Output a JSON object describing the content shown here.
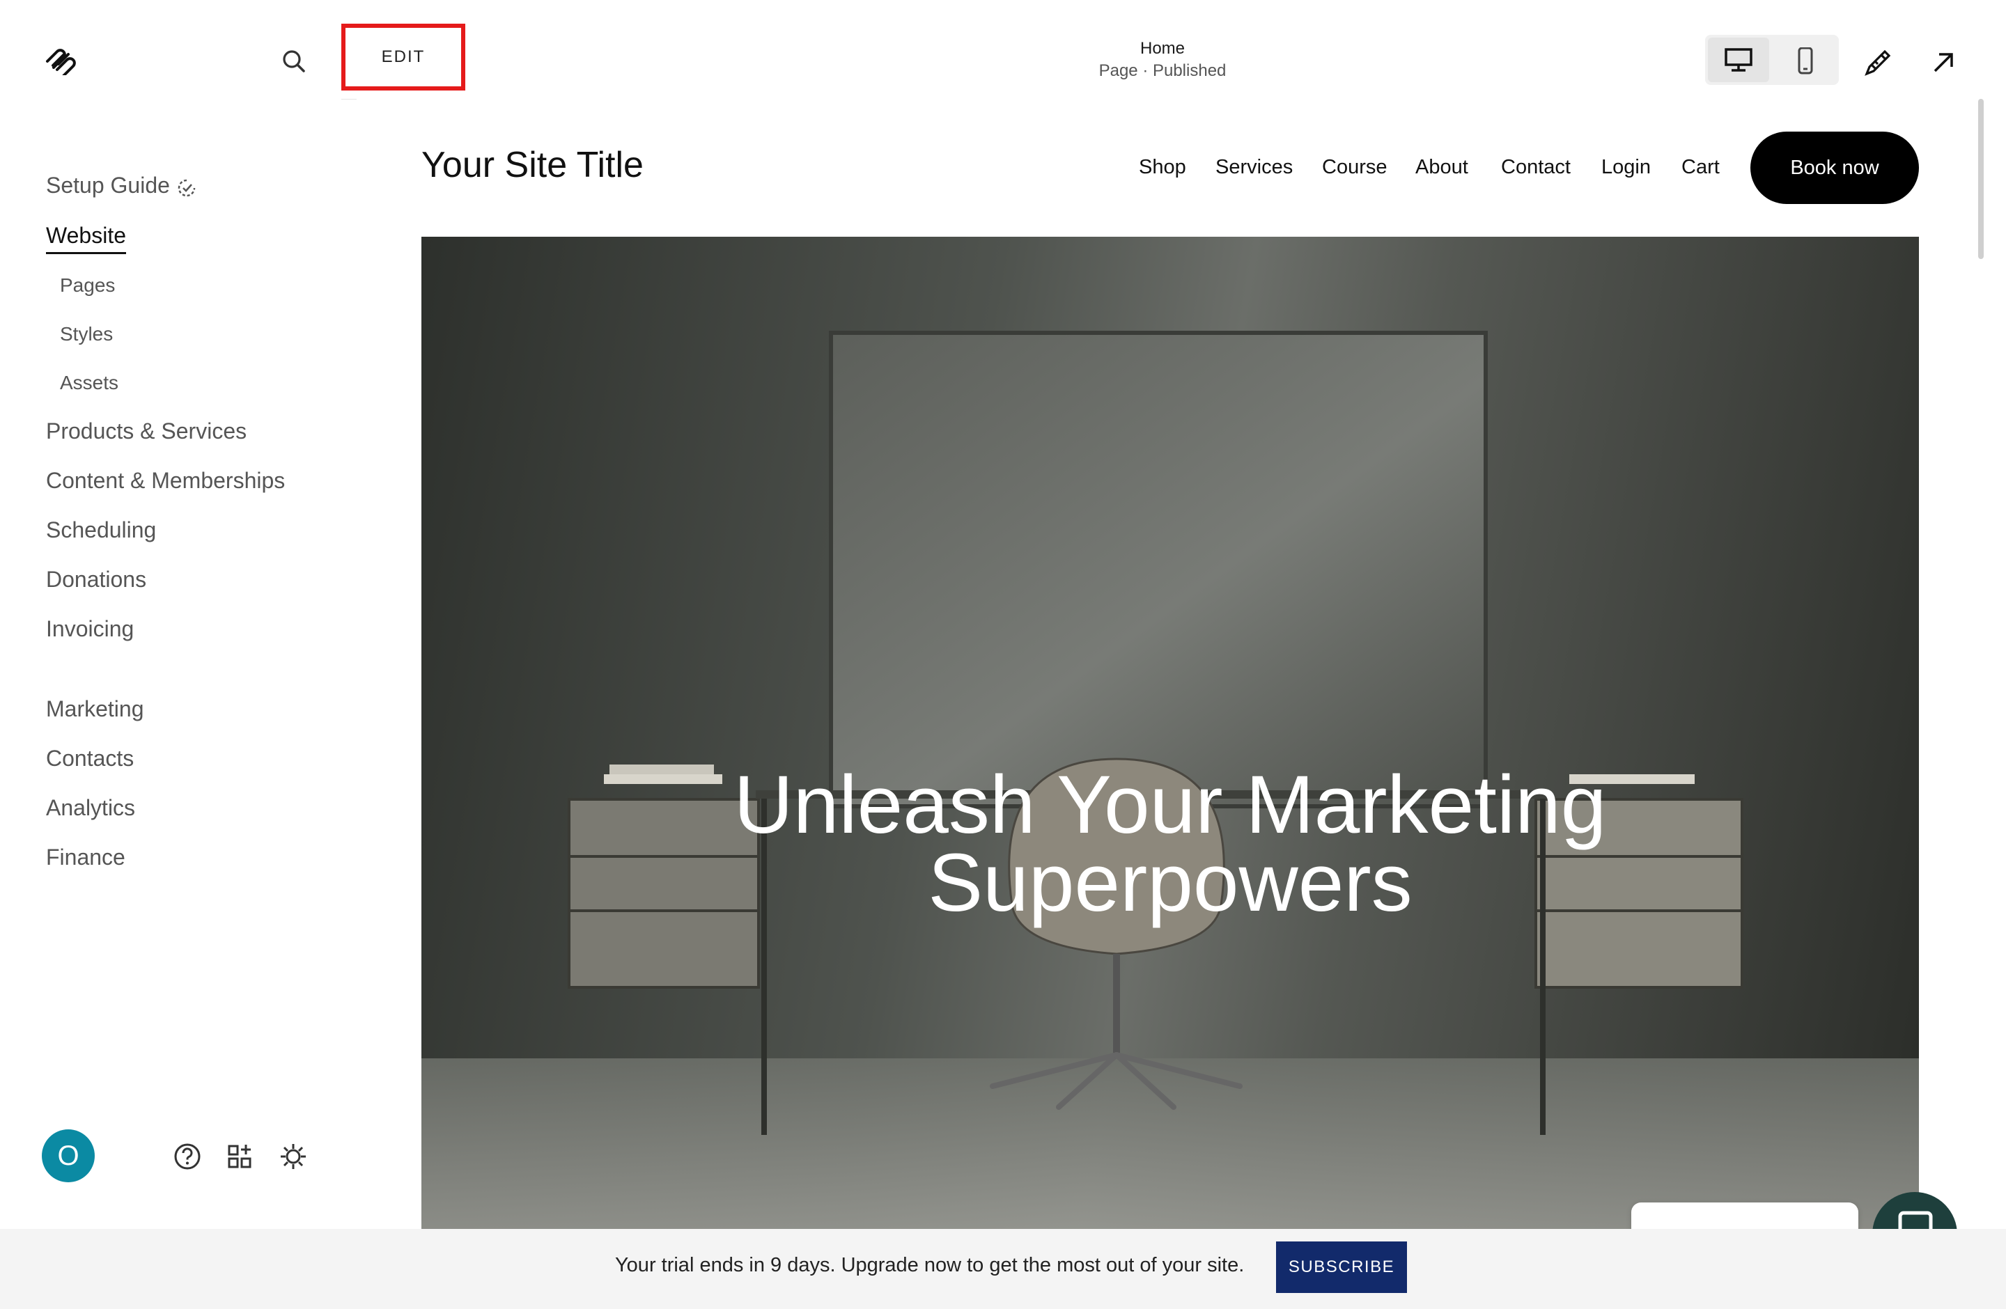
{
  "sidebar": {
    "items": [
      {
        "label": "Setup Guide"
      },
      {
        "label": "Website"
      },
      {
        "label": "Pages"
      },
      {
        "label": "Styles"
      },
      {
        "label": "Assets"
      },
      {
        "label": "Products & Services"
      },
      {
        "label": "Content & Memberships"
      },
      {
        "label": "Scheduling"
      },
      {
        "label": "Donations"
      },
      {
        "label": "Invoicing"
      },
      {
        "label": "Marketing"
      },
      {
        "label": "Contacts"
      },
      {
        "label": "Analytics"
      },
      {
        "label": "Finance"
      }
    ],
    "avatar_initial": "O"
  },
  "topbar": {
    "edit_label": "EDIT",
    "page_title": "Home",
    "page_status": "Page · Published"
  },
  "site": {
    "title": "Your Site Title",
    "nav": [
      "Shop",
      "Services",
      "Course",
      "About",
      "Contact",
      "Login",
      "Cart"
    ],
    "cta": "Book now",
    "headline_line1": "Unleash Your Marketing",
    "headline_line2": "Superpowers"
  },
  "banner": {
    "text": "Your trial ends in 9 days. Upgrade now to get the most out of your site.",
    "subscribe_label": "SUBSCRIBE"
  },
  "colors": {
    "accent_red": "#e51b1b",
    "avatar_teal": "#0b8aa3",
    "subscribe_navy": "#122a6b"
  }
}
